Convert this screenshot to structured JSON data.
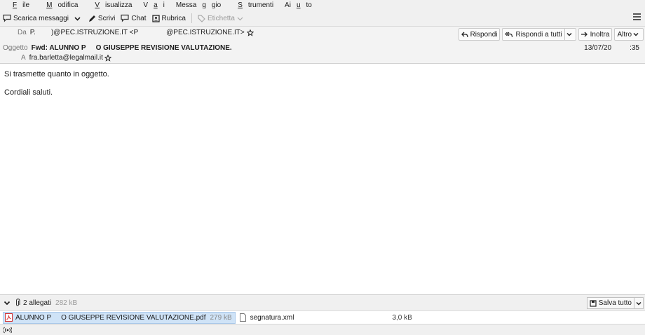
{
  "menubar": {
    "items": [
      {
        "pre": "",
        "u": "F",
        "post": "ile"
      },
      {
        "pre": "",
        "u": "M",
        "post": "odifica"
      },
      {
        "pre": "",
        "u": "V",
        "post": "isualizza"
      },
      {
        "pre": "V",
        "u": "a",
        "post": "i"
      },
      {
        "pre": "Messa",
        "u": "g",
        "post": "gio"
      },
      {
        "pre": "",
        "u": "S",
        "post": "trumenti"
      },
      {
        "pre": "Ai",
        "u": "u",
        "post": "to"
      }
    ]
  },
  "toolbar": {
    "get_messages": "Scarica messaggi",
    "write": "Scrivi",
    "chat": "Chat",
    "address_book": "Rubrica",
    "tag": "Etichetta"
  },
  "header": {
    "from_label": "Da",
    "from_name_a": "P.",
    "from_address_a": ")@PEC.ISTRUZIONE.IT <P",
    "from_address_b": "@PEC.ISTRUZIONE.IT>",
    "subject_label": "Oggetto",
    "subject_a": "Fwd: ALUNNO P",
    "subject_b": "O GIUSEPPE REVISIONE VALUTAZIONE.",
    "to_label": "A",
    "to_address": "fra.barletta@legalmail.it",
    "date_a": "13/07/20",
    "date_b": ":35",
    "actions": {
      "reply": "Rispondi",
      "reply_all": "Rispondi a tutti",
      "forward": "Inoltra",
      "more": "Altro"
    }
  },
  "message": {
    "lines": [
      "Si trasmette quanto in oggetto.",
      "Cordiali saluti."
    ]
  },
  "attachments": {
    "count_label": "2 allegati",
    "total_size": "282 kB",
    "save_all": "Salva tutto",
    "items": [
      {
        "name_a": "ALUNNO P",
        "name_b": "O GIUSEPPE REVISIONE VALUTAZIONE.pdf",
        "size": "279 kB"
      },
      {
        "name": "segnatura.xml",
        "size": "3,0 kB"
      }
    ]
  },
  "colors": {
    "chrome": "#f0f0f0",
    "header_bg": "#f3f3f3",
    "selected_attachment": "#cfe3f7",
    "pdf_red": "#d32f2f"
  }
}
